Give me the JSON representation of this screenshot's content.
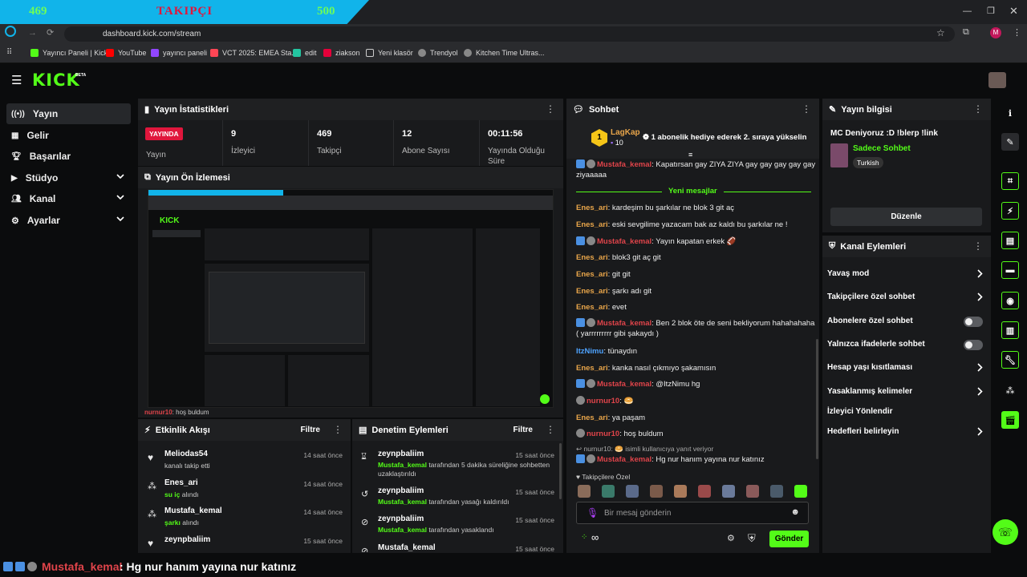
{
  "overlay": {
    "left": "469",
    "center": "TAKIPÇI",
    "right": "500",
    "fill_fraction": 0.938
  },
  "browser": {
    "url": "dashboard.kick.com/stream",
    "bookmarks": [
      "Yayıncı Paneli | Kick",
      "YouTube",
      "yayıncı paneli",
      "VCT 2025: EMEA Sta...",
      "edit",
      "ziakson",
      "Yeni klasör",
      "Trendyol",
      "Kitchen Time Ultras..."
    ],
    "profile_initial": "M"
  },
  "app": {
    "logo": "KICK",
    "logo_tag": "BETA"
  },
  "sidebar": [
    {
      "label": "Yayın",
      "icon": "radio-icon"
    },
    {
      "label": "Gelir",
      "icon": "dollar-icon"
    },
    {
      "label": "Başarılar",
      "icon": "trophy-icon"
    },
    {
      "label": "Stüdyo",
      "icon": "video-icon"
    },
    {
      "label": "Kanal",
      "icon": "users-icon"
    },
    {
      "label": "Ayarlar",
      "icon": "gear-icon"
    }
  ],
  "stats": {
    "title": "Yayın İstatistikleri",
    "live_badge": "YAYINDA",
    "live_label": "Yayın",
    "items": [
      {
        "value": "9",
        "label": "İzleyici"
      },
      {
        "value": "469",
        "label": "Takipçi"
      },
      {
        "value": "12",
        "label": "Abone Sayısı"
      },
      {
        "value": "00:11:56",
        "label": "Yayında Olduğu Süre"
      }
    ]
  },
  "preview": {
    "title": "Yayın Ön İzlemesi",
    "caption_user": "nurnur10",
    "caption_text": ": hoş buldum"
  },
  "activity": {
    "title": "Etkinlik Akışı",
    "filter": "Filtre",
    "items": [
      {
        "name": "Meliodas54",
        "desc": "kanalı takip etti",
        "time": "14 saat önce",
        "icon": "heart-icon"
      },
      {
        "name": "Enes_ari",
        "hl": "su iç",
        "desc": " alındı",
        "time": "14 saat önce",
        "icon": "points-icon"
      },
      {
        "name": "Mustafa_kemal",
        "hl": "şarkı",
        "desc": " alındı",
        "time": "14 saat önce",
        "icon": "points-icon"
      },
      {
        "name": "zeynpbaliim",
        "desc": "",
        "time": "15 saat önce",
        "icon": "heart-icon"
      }
    ]
  },
  "moderation": {
    "title": "Denetim Eylemleri",
    "filter": "Filtre",
    "items": [
      {
        "name": "zeynpbaliim",
        "by": "Mustafa_kemal",
        "desc": " tarafından 5 dakika süreliğine sohbetten uzaklaştırıldı",
        "time": "15 saat önce",
        "icon": "hourglass-icon"
      },
      {
        "name": "zeynpbaliim",
        "by": "Mustafa_kemal",
        "desc": " tarafından yasağı kaldırıldı",
        "time": "15 saat önce",
        "icon": "undo-icon"
      },
      {
        "name": "zeynpbaliim",
        "by": "Mustafa_kemal",
        "desc": " tarafından yasaklandı",
        "time": "15 saat önce",
        "icon": "ban-icon"
      },
      {
        "name": "Mustafa_kemal",
        "by": "",
        "desc": "",
        "time": "15 saat önce",
        "icon": "ban-icon"
      }
    ]
  },
  "chat": {
    "title": "Sohbet",
    "pinned_user": "LagKap",
    "pinned_rank": "1",
    "pinned_count": "10",
    "pinned_text": "1 abonelik hediye ederek 2. sıraya yükselin",
    "top_partial_user": "Mustafa_kemal",
    "top_partial_text": ": Kapatırsan gay ZIYA ZIYA gay gay gay gay gay ziyaaaaa",
    "new_messages": "Yeni mesajlar",
    "messages": [
      {
        "user": "Enes_ari",
        "color": "o",
        "text": ": kardeşim bu şarkılar ne blok 3 git aç"
      },
      {
        "user": "Enes_ari",
        "color": "o",
        "text": ": eski sevgilime yazacam bak az kaldı bu şarkılar ne !"
      },
      {
        "user": "Mustafa_kemal",
        "color": "r",
        "text": ": Yayın kapatan erkek 🏈",
        "badges": true
      },
      {
        "user": "Enes_ari",
        "color": "o",
        "text": ": blok3 git aç git"
      },
      {
        "user": "Enes_ari",
        "color": "o",
        "text": ": git git"
      },
      {
        "user": "Enes_ari",
        "color": "o",
        "text": ": şarkı adı git"
      },
      {
        "user": "Enes_ari",
        "color": "o",
        "text": ": evet"
      },
      {
        "user": "Mustafa_kemal",
        "color": "r",
        "text": ": Ben 2 blok öte de seni bekliyorum hahahahaha ( yarrrrrrrrr gibi şakaydı )",
        "badges": true
      },
      {
        "user": "ItzNimu",
        "color": "b",
        "text": ": tünaydın"
      },
      {
        "user": "Enes_ari",
        "color": "o",
        "text": ": kanka nasıl çıkmıyo şakamısın"
      },
      {
        "user": "Mustafa_kemal",
        "color": "r",
        "text": ": @ItzNimu hg",
        "badges": true
      },
      {
        "user": "nurnur10",
        "color": "r",
        "text": ": 🥯",
        "gray_badge": true
      },
      {
        "user": "Enes_ari",
        "color": "o",
        "text": ": ya paşam"
      },
      {
        "user": "nurnur10",
        "color": "r",
        "text": ": hoş buldum",
        "gray_badge": true
      }
    ],
    "reply_to_user": "nurnur10:",
    "reply_to_text": "isimli kullanıcıya yanıt veriyor",
    "reply_user": "Mustafa_kemal",
    "reply_text": ": Hg nur hanım yayına nur katınız",
    "follower_only_label": "Takipçilere Özel",
    "input_placeholder": "Bir mesaj gönderin",
    "infinity": "∞",
    "send": "Gönder"
  },
  "stream_info": {
    "title": "Yayın bilgisi",
    "stream_title": "MC Deniyoruz :D !blerp !link",
    "category": "Sadece Sohbet",
    "language": "Turkish",
    "edit": "Düzenle"
  },
  "channel_actions": {
    "title": "Kanal Eylemleri",
    "items": [
      {
        "label": "Yavaş mod",
        "type": "arrow"
      },
      {
        "label": "Takipçilere özel sohbet",
        "type": "arrow"
      },
      {
        "label": "Abonelere özel sohbet",
        "type": "toggle",
        "on": false
      },
      {
        "label": "Yalnızca ifadelerle sohbet",
        "type": "toggle",
        "on": false
      },
      {
        "label": "Hesap yaşı kısıtlaması",
        "type": "arrow"
      },
      {
        "label": "Yasaklanmış kelimeler",
        "type": "arrow"
      },
      {
        "label": "İzleyici Yönlendir",
        "type": "none"
      },
      {
        "label": "Hedefleri belirleyin",
        "type": "arrow"
      }
    ]
  },
  "bottom": {
    "user": "Mustafa_kemal",
    "text": ": Hg nur hanım yayına nur katınız"
  },
  "colors": {
    "kick_green": "#53fc18",
    "panel": "#191a1c",
    "live_red": "#e0163c"
  }
}
